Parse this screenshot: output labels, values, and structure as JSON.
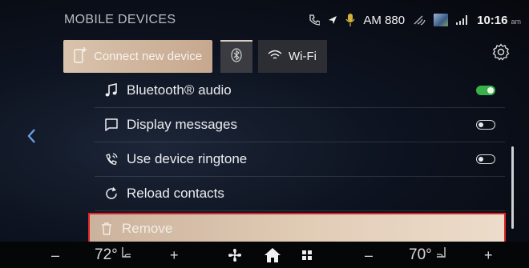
{
  "header": {
    "title": "MOBILE DEVICES"
  },
  "status": {
    "radio": "AM 880",
    "time": "10:16",
    "ampm": "am"
  },
  "toolbar": {
    "connect_label": "Connect new device",
    "wifi_label": "Wi-Fi"
  },
  "list": {
    "items": [
      {
        "label": "Bluetooth® audio",
        "icon": "music-note-icon",
        "toggle": "on"
      },
      {
        "label": "Display messages",
        "icon": "message-icon",
        "toggle": "off"
      },
      {
        "label": "Use device ringtone",
        "icon": "ringtone-icon",
        "toggle": "off"
      },
      {
        "label": "Reload contacts",
        "icon": "reload-icon",
        "toggle": null
      },
      {
        "label": "Remove",
        "icon": "trash-icon",
        "toggle": null
      }
    ]
  },
  "climate": {
    "left_minus": "–",
    "left_temp": "72°",
    "left_plus": "+",
    "right_minus": "–",
    "right_temp": "70°",
    "right_plus": "+"
  },
  "colors": {
    "accent": "#c6a88e",
    "toggle_on": "#38b14a",
    "highlight": "#e02424"
  }
}
